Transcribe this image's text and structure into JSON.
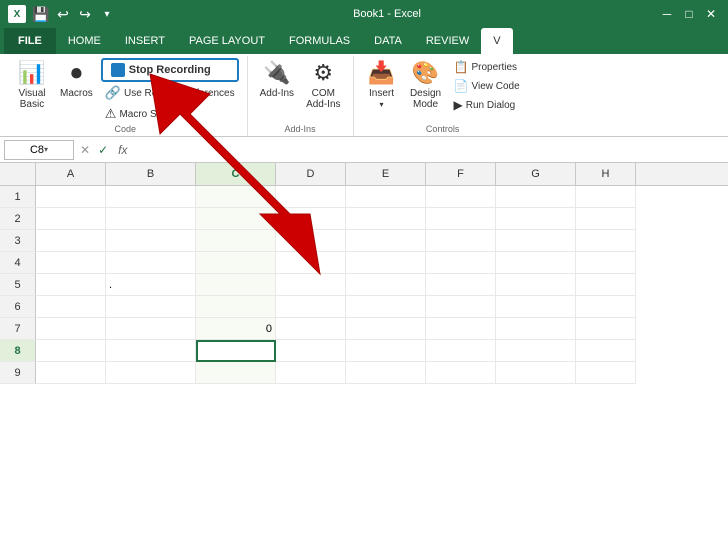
{
  "titleBar": {
    "title": "Book1 - Excel",
    "saveIcon": "💾",
    "undoIcon": "↩",
    "redoIcon": "↪",
    "moreIcon": "▾"
  },
  "ribbonTabs": [
    "FILE",
    "HOME",
    "INSERT",
    "PAGE LAYOUT",
    "FORMULAS",
    "DATA",
    "REVIEW",
    "V"
  ],
  "activeTab": "HOME",
  "ribbon": {
    "groups": [
      {
        "label": "Code",
        "items": [
          {
            "type": "large",
            "icon": "📊",
            "label": "Visual\nBasic"
          },
          {
            "type": "large",
            "icon": "⏺",
            "label": "Macros"
          },
          {
            "type": "small-stack",
            "items": [
              {
                "label": "Stop Recording",
                "icon": "■"
              },
              {
                "label": "Use Relative References",
                "icon": "🔗"
              },
              {
                "label": "Macro Security",
                "icon": "⚠"
              }
            ]
          }
        ]
      },
      {
        "label": "Add-Ins",
        "items": [
          {
            "type": "large",
            "icon": "🔌",
            "label": "Add-Ins"
          },
          {
            "type": "large",
            "icon": "⚙",
            "label": "COM\nAdd-Ins"
          }
        ]
      },
      {
        "label": "Controls",
        "items": [
          {
            "type": "large",
            "icon": "📥",
            "label": "Insert\n▾"
          },
          {
            "type": "large",
            "icon": "🎨",
            "label": "Design\nMode"
          },
          {
            "type": "small-stack",
            "items": [
              {
                "label": "Properties",
                "icon": "📋"
              },
              {
                "label": "View Code",
                "icon": "📄"
              },
              {
                "label": "Run Dialog",
                "icon": "▶"
              }
            ]
          }
        ]
      }
    ]
  },
  "formulaBar": {
    "nameBox": "C8",
    "dropdownArrow": "▾",
    "cancelBtn": "✕",
    "confirmBtn": "✓",
    "fxLabel": "fx",
    "value": ""
  },
  "spreadsheet": {
    "columns": [
      "A",
      "B",
      "C",
      "D",
      "E",
      "F",
      "G",
      "H"
    ],
    "activeCol": "C",
    "activeRow": 8,
    "rows": [
      {
        "num": 1,
        "cells": [
          "",
          "",
          "",
          "",
          "",
          "",
          "",
          ""
        ]
      },
      {
        "num": 2,
        "cells": [
          "",
          "",
          "",
          "",
          "",
          "",
          "",
          ""
        ]
      },
      {
        "num": 3,
        "cells": [
          "",
          "",
          "",
          "",
          "",
          "",
          "",
          ""
        ]
      },
      {
        "num": 4,
        "cells": [
          "",
          "",
          "",
          "",
          "",
          "",
          "",
          ""
        ]
      },
      {
        "num": 5,
        "cells": [
          "",
          ".",
          "",
          "",
          "",
          "",
          "",
          ""
        ]
      },
      {
        "num": 6,
        "cells": [
          "",
          "",
          "",
          "",
          "",
          "",
          "",
          ""
        ]
      },
      {
        "num": 7,
        "cells": [
          "",
          "",
          "0",
          "",
          "",
          "",
          "",
          ""
        ]
      },
      {
        "num": 8,
        "cells": [
          "",
          "",
          "",
          "",
          "",
          "",
          "",
          ""
        ]
      },
      {
        "num": 9,
        "cells": [
          "",
          "",
          "",
          "",
          "",
          "",
          "",
          ""
        ]
      }
    ]
  },
  "arrow": {
    "color": "#cc0000"
  }
}
